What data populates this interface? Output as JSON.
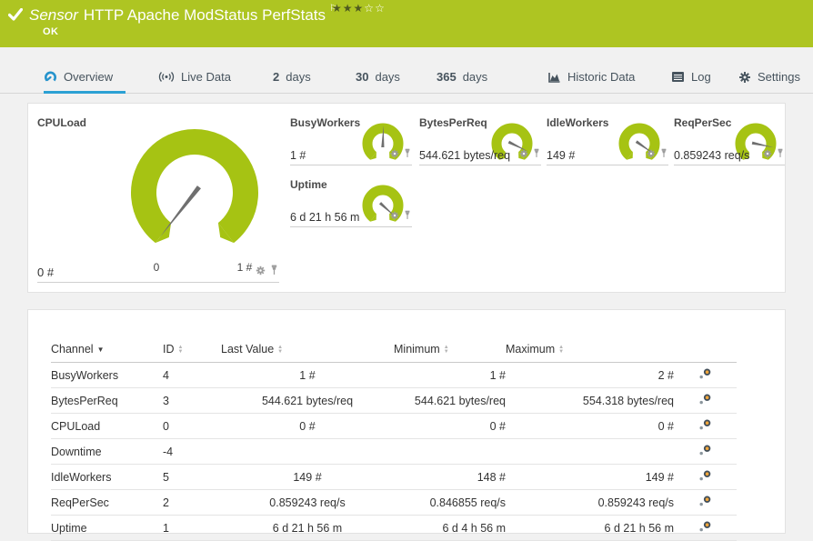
{
  "titlebar": {
    "kind_label": "Sensor",
    "title": "HTTP Apache ModStatus PerfStats",
    "flag_glyph": "⚐",
    "status_text": "OK",
    "priority_stars_filled": 3,
    "priority_stars_total": 5
  },
  "tabs": [
    {
      "label": "Overview",
      "icon": "gauge-icon",
      "active": true
    },
    {
      "label": "Live Data",
      "icon": "live-icon"
    },
    {
      "prefix": "2",
      "label": "days"
    },
    {
      "prefix": "30",
      "label": "days"
    },
    {
      "prefix": "365",
      "label": "days"
    },
    {
      "label": "Historic Data",
      "icon": "chart-icon"
    },
    {
      "label": "Log",
      "icon": "log-icon"
    },
    {
      "label": "Settings",
      "icon": "gear-icon"
    }
  ],
  "colors": {
    "header_green": "#aec522",
    "gauge_green": "#a6c313",
    "needle_gray": "#6f6f6f",
    "tab_blue": "#2ba0d3"
  },
  "chart_data": {
    "type": "gauges",
    "gauges": [
      {
        "name": "CPULoad",
        "value_label": "0 #",
        "scale_min_label": "0",
        "scale_max_label": "1 #",
        "needle_angle": 128,
        "size": "large"
      },
      {
        "name": "BusyWorkers",
        "value_label": "1 #",
        "needle_angle": 272,
        "size": "small"
      },
      {
        "name": "BytesPerReq",
        "value_label": "544.621 bytes/req",
        "needle_angle": 26,
        "size": "small"
      },
      {
        "name": "IdleWorkers",
        "value_label": "149 #",
        "needle_angle": 35,
        "size": "small"
      },
      {
        "name": "ReqPerSec",
        "value_label": "0.859243 req/s",
        "needle_angle": 12,
        "size": "small"
      },
      {
        "name": "Uptime",
        "value_label": "6 d 21 h 56 m",
        "needle_angle": 42,
        "size": "small"
      }
    ]
  },
  "table": {
    "columns": {
      "channel": "Channel",
      "id": "ID",
      "last": "Last Value",
      "min": "Minimum",
      "max": "Maximum"
    },
    "rows": [
      {
        "channel": "BusyWorkers",
        "id": "4",
        "last": "1 #",
        "min": "1 #",
        "max": "2 #"
      },
      {
        "channel": "BytesPerReq",
        "id": "3",
        "last": "544.621 bytes/req",
        "min": "544.621 bytes/req",
        "max": "554.318 bytes/req"
      },
      {
        "channel": "CPULoad",
        "id": "0",
        "last": "0 #",
        "min": "0 #",
        "max": "0 #"
      },
      {
        "channel": "Downtime",
        "id": "-4",
        "last": "",
        "min": "",
        "max": ""
      },
      {
        "channel": "IdleWorkers",
        "id": "5",
        "last": "149 #",
        "min": "148 #",
        "max": "149 #"
      },
      {
        "channel": "ReqPerSec",
        "id": "2",
        "last": "0.859243 req/s",
        "min": "0.846855 req/s",
        "max": "0.859243 req/s"
      },
      {
        "channel": "Uptime",
        "id": "1",
        "last": "6 d 21 h 56 m",
        "min": "6 d 4 h 56 m",
        "max": "6 d 21 h 56 m"
      }
    ]
  }
}
